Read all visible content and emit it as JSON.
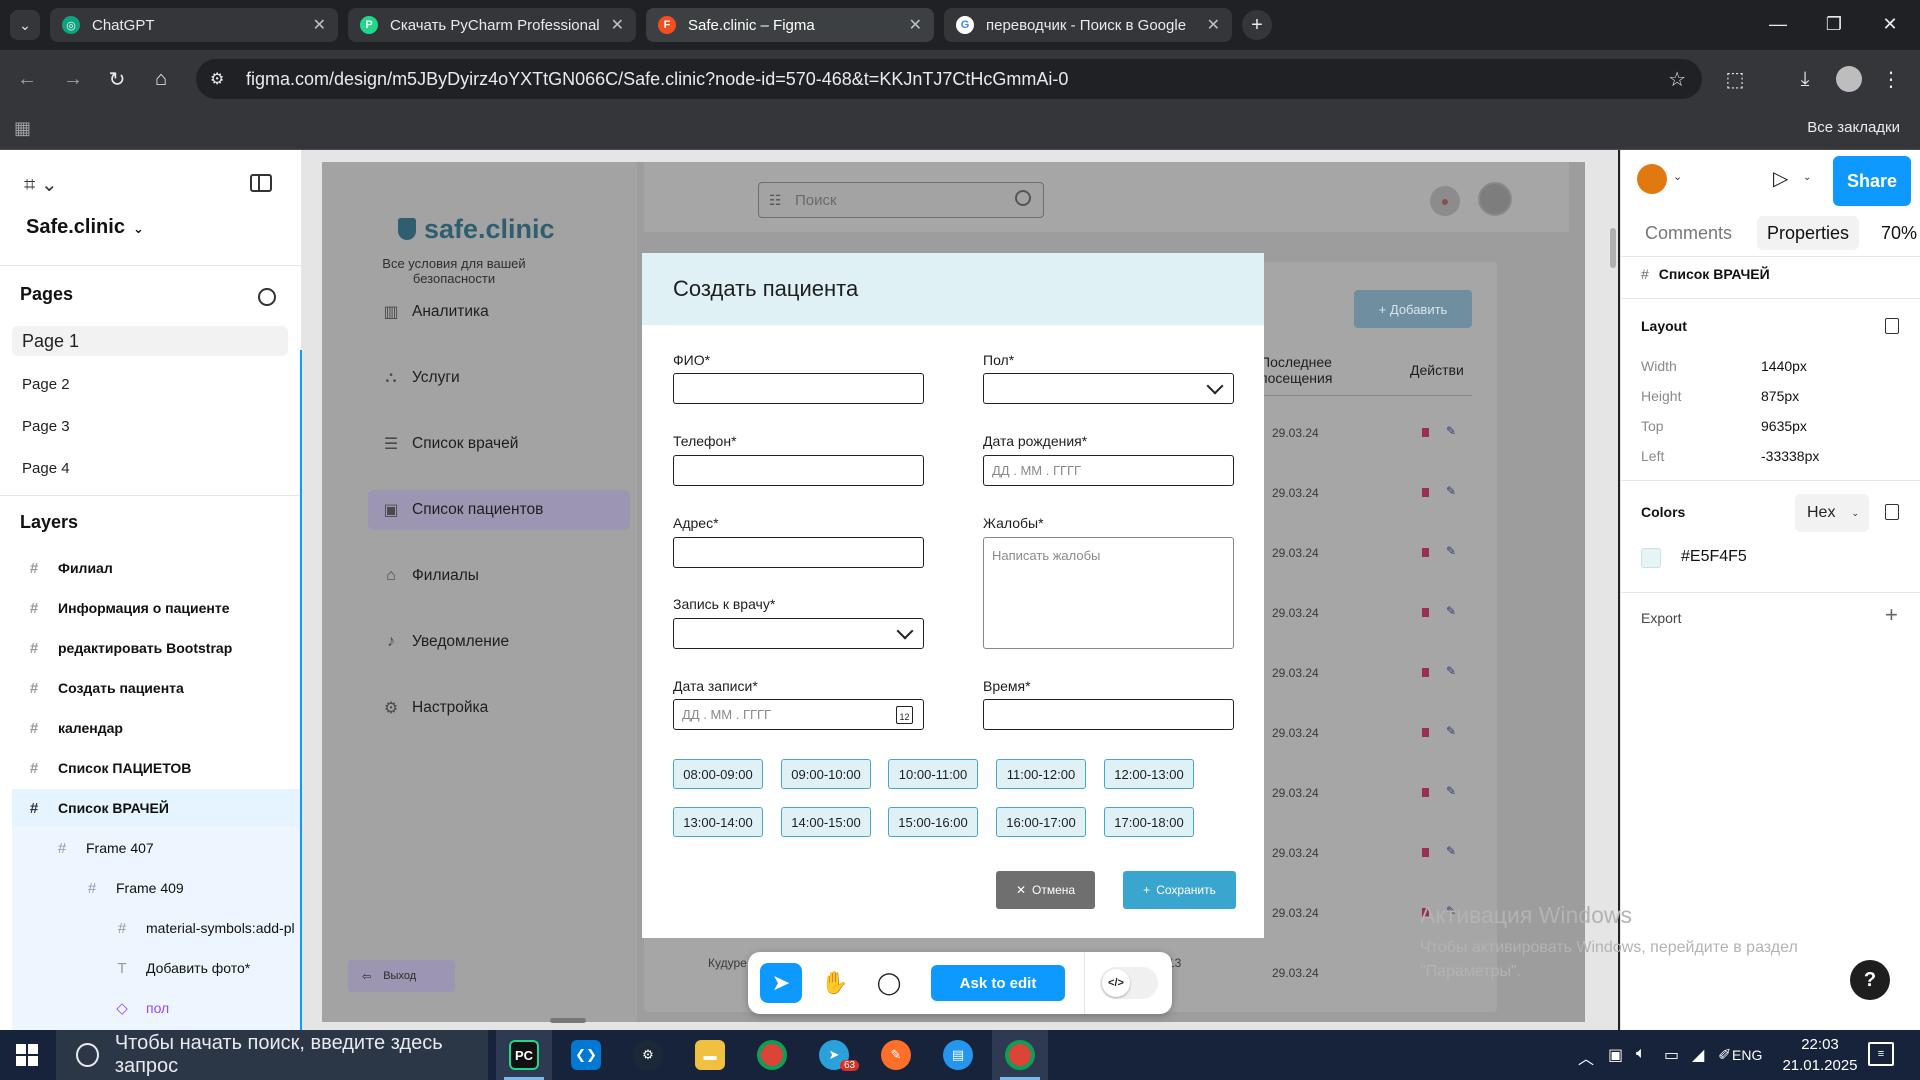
{
  "browser": {
    "tabs": [
      {
        "title": "ChatGPT",
        "icon": "chatgpt-icon",
        "color": "#10a37f"
      },
      {
        "title": "Скачать PyCharm Professional",
        "icon": "pycharm-icon",
        "color": "#21d789"
      },
      {
        "title": "Safe.clinic – Figma",
        "icon": "figma-icon",
        "color": "#f24e1e"
      },
      {
        "title": "переводчик - Поиск в Google",
        "icon": "google-icon",
        "color": "#4285f4"
      }
    ],
    "url": "figma.com/design/m5JByDyirz4oYXTtGN066C/Safe.clinic?node-id=570-468&t=KKJnTJ7CtHcGmmAi-0",
    "all_bookmarks": "Все закладки"
  },
  "figma": {
    "file_name": "Safe.clinic",
    "pages_title": "Pages",
    "pages": [
      "Page 1",
      "Page 2",
      "Page 3",
      "Page 4"
    ],
    "layers_title": "Layers",
    "layers": [
      {
        "name": "Филиал",
        "icon": "frame-icon"
      },
      {
        "name": "Информация о пациенте",
        "icon": "frame-icon"
      },
      {
        "name": "редактировать Bootstrap",
        "icon": "frame-icon"
      },
      {
        "name": "Создать  пациента",
        "icon": "frame-icon"
      },
      {
        "name": "календар",
        "icon": "frame-icon"
      },
      {
        "name": "Список ПАЦИЕТОВ",
        "icon": "frame-icon"
      },
      {
        "name": "Список ВРАЧЕЙ",
        "icon": "frame-icon"
      },
      {
        "name": "Frame 407",
        "icon": "frame-icon"
      },
      {
        "name": "Frame 409",
        "icon": "frame-icon"
      },
      {
        "name": "material-symbols:add-pl",
        "icon": "frame-icon"
      },
      {
        "name": "Добавить фото*",
        "icon": "text-icon"
      },
      {
        "name": "пол",
        "icon": "component-icon"
      }
    ],
    "toolbar": {
      "ask_to_edit": "Ask to edit"
    },
    "right": {
      "share": "Share",
      "tab_comments": "Comments",
      "tab_properties": "Properties",
      "zoom": "70%",
      "selected_frame": "Список ВРАЧЕЙ",
      "layout_title": "Layout",
      "width_label": "Width",
      "width_value": "1440px",
      "height_label": "Height",
      "height_value": "875px",
      "top_label": "Top",
      "top_value": "9635px",
      "left_label": "Left",
      "left_value": "-33338px",
      "colors_title": "Colors",
      "color_format": "Hex",
      "color_value": "#E5F4F5",
      "export_title": "Export"
    }
  },
  "design": {
    "brand": "safe.clinic",
    "brand_sub": "Все условия для вашей безопасности",
    "nav": [
      {
        "label": "Аналитика",
        "icon": "analytics-icon"
      },
      {
        "label": "Услуги",
        "icon": "services-icon"
      },
      {
        "label": "Список врачей",
        "icon": "doctors-icon"
      },
      {
        "label": "Список пациентов",
        "icon": "patients-icon"
      },
      {
        "label": "Филиалы",
        "icon": "branches-icon"
      },
      {
        "label": "Уведомление",
        "icon": "bell-icon"
      },
      {
        "label": "Настройка",
        "icon": "settings-icon"
      }
    ],
    "logout": "Выход",
    "search_placeholder": "Поиск",
    "add_button": "+ Добавить",
    "col_last_visit": "Последнее посещения",
    "col_actions": "Действи",
    "dates": [
      "29.03.24",
      "29.03.24",
      "29.03.24",
      "29.03.24",
      "29.03.24",
      "29.03.24",
      "29.03.24",
      "29.03.24",
      "29.03.24",
      "29.03.24"
    ],
    "last_row_name": "Кудуре",
    "last_row_num": "13",
    "modal": {
      "title": "Создать  пациента",
      "fio_label": "ФИО*",
      "gender_label": "Пол*",
      "phone_label": "Телефон*",
      "birth_label": "Дата рождения*",
      "birth_placeholder": "ДД . ММ . ГГГГ",
      "address_label": "Адрес*",
      "complaints_label": "Жалобы*",
      "complaints_placeholder": "Написать жалобы",
      "doctor_label": "Запись к врачу*",
      "visit_date_label": "Дата записи*",
      "visit_date_placeholder": "ДД . ММ . ГГГГ",
      "calendar_day": "12",
      "time_label": "Время*",
      "slots": [
        "08:00-09:00",
        "09:00-10:00",
        "10:00-11:00",
        "11:00-12:00",
        "12:00-13:00",
        "13:00-14:00",
        "14:00-15:00",
        "15:00-16:00",
        "16:00-17:00",
        "17:00-18:00"
      ],
      "cancel": "Отмена",
      "save": "Сохранить"
    }
  },
  "windows": {
    "activation_title": "Активация Windows",
    "activation_text": "Чтобы активировать Windows, перейдите в раздел \"Параметры\".",
    "search_placeholder": "Чтобы начать поиск, введите здесь запрос",
    "language": "ENG",
    "time": "22:03",
    "date": "21.01.2025",
    "telegram_badge": "63",
    "apps": [
      "pycharm-icon",
      "vscode-icon",
      "steam-icon",
      "explorer-icon",
      "chrome-icon",
      "telegram-icon",
      "paint-icon",
      "docker-icon",
      "chrome-icon"
    ]
  }
}
